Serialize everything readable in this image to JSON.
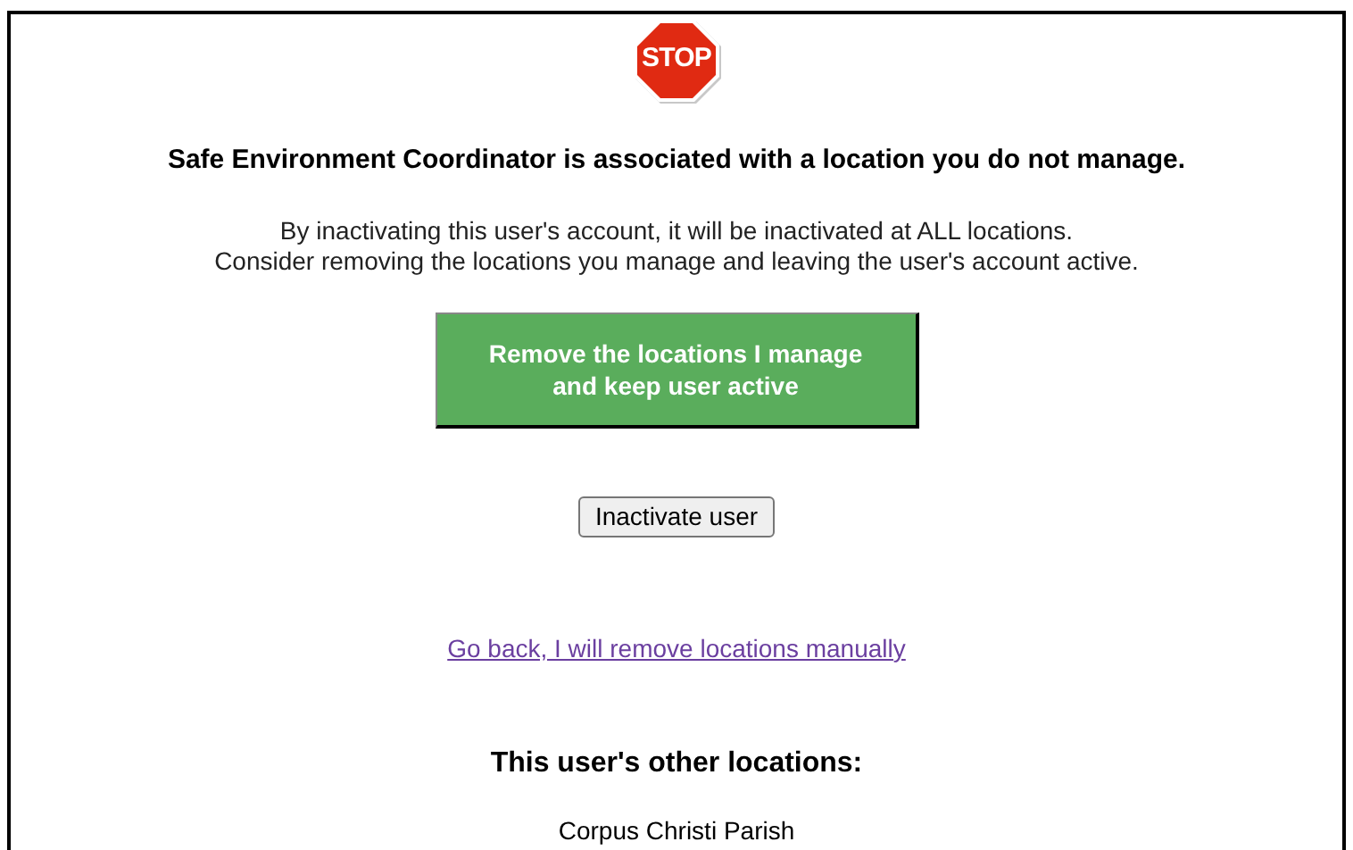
{
  "stop_sign": {
    "label": "STOP"
  },
  "heading": "Safe Environment Coordinator is associated with a location you do not manage.",
  "message_lines": [
    "By inactivating this user's account, it will be inactivated at ALL locations.",
    "Consider removing the locations you manage and leaving the user's account active."
  ],
  "primary_button": {
    "lines": [
      "Remove the locations I manage",
      "and keep user active"
    ]
  },
  "secondary_button": "Inactivate user",
  "link": "Go back, I will remove locations manually",
  "other_locations": {
    "heading": "This user's other locations:",
    "items": [
      "Corpus Christi Parish"
    ]
  }
}
